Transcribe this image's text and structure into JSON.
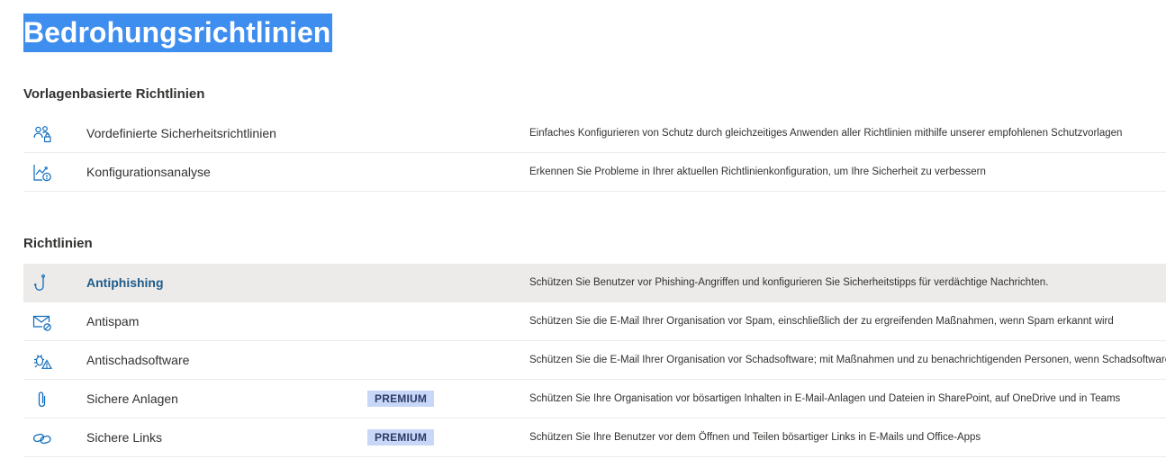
{
  "page": {
    "title": "Bedrohungsrichtlinien"
  },
  "sections": {
    "templates": {
      "heading": "Vorlagenbasierte Richtlinien",
      "items": [
        {
          "name": "Vordefinierte Sicherheitsrichtlinien",
          "icon": "people-lock-icon",
          "description": "Einfaches Konfigurieren von Schutz durch gleichzeitiges Anwenden aller Richtlinien mithilfe unserer empfohlenen Schutzvorlagen"
        },
        {
          "name": "Konfigurationsanalyse",
          "icon": "chart-alert-icon",
          "description": "Erkennen Sie Probleme in Ihrer aktuellen Richtlinienkonfiguration, um Ihre Sicherheit zu verbessern"
        }
      ]
    },
    "policies": {
      "heading": "Richtlinien",
      "items": [
        {
          "name": "Antiphishing",
          "icon": "fishhook-icon",
          "description": "Schützen Sie Benutzer vor Phishing-Angriffen und konfigurieren Sie Sicherheitstipps für verdächtige Nachrichten.",
          "selected": true
        },
        {
          "name": "Antispam",
          "icon": "mail-block-icon",
          "description": "Schützen Sie die E-Mail Ihrer Organisation vor Spam, einschließlich der zu ergreifenden Maßnahmen, wenn Spam erkannt wird"
        },
        {
          "name": "Antischadsoftware",
          "icon": "bug-warning-icon",
          "description": "Schützen Sie die E-Mail Ihrer Organisation vor Schadsoftware; mit Maßnahmen und zu benachrichtigenden Personen, wenn Schadsoftware erkannt wird"
        },
        {
          "name": "Sichere Anlagen",
          "icon": "paperclip-icon",
          "badge": "PREMIUM",
          "description": "Schützen Sie Ihre Organisation vor bösartigen Inhalten in E-Mail-Anlagen und Dateien in SharePoint, auf OneDrive und in Teams"
        },
        {
          "name": "Sichere Links",
          "icon": "link-icon",
          "badge": "PREMIUM",
          "description": "Schützen Sie Ihre Benutzer vor dem Öffnen und Teilen bösartiger Links in E-Mails und Office-Apps"
        }
      ]
    }
  },
  "colors": {
    "icon": "#0f6cbd",
    "title_highlight": "#3e8ef0",
    "badge_bg": "#c8d7f7",
    "selected_row": "#edebe9",
    "selected_link": "#1f5c8b"
  }
}
